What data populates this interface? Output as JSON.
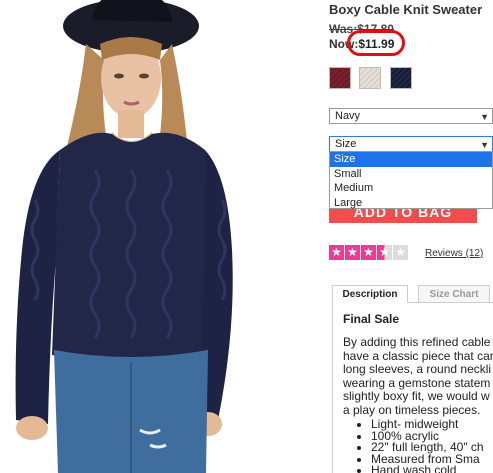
{
  "product": {
    "title": "Boxy Cable Knit Sweater",
    "was_price": "Was:$17.80",
    "now_label": "Now:",
    "now_price": "$11.99"
  },
  "swatches": [
    {
      "name": "burgundy",
      "color": "#6a1a24"
    },
    {
      "name": "cream",
      "color": "#e2dbd0"
    },
    {
      "name": "navy",
      "color": "#1b2140"
    }
  ],
  "color_select": {
    "value": "Navy"
  },
  "size_select": {
    "value": "Size",
    "options": [
      "Size",
      "Small",
      "Medium",
      "Large"
    ],
    "highlighted": "Size"
  },
  "add_to_bag": {
    "label": "ADD TO BAG"
  },
  "rating": {
    "stars": 3.5,
    "max": 5
  },
  "reviews": {
    "label": "Reviews (12)"
  },
  "tabs": [
    {
      "label": "Description",
      "active": true
    },
    {
      "label": "Size Chart",
      "active": false
    }
  ],
  "description": {
    "heading": "Final Sale",
    "lines": [
      "By adding this refined cable",
      "have a classic piece that car",
      "long sleeves, a round neckli",
      "wearing a gemstone statem",
      "slightly boxy fit, we would w",
      "a play on timeless pieces."
    ],
    "bullets": [
      "Light- midweight",
      "100% acrylic",
      "22\" full length, 40\" ch",
      "Measured from Sma",
      "Hand wash cold"
    ]
  },
  "colors": {
    "accent_red": "#e01010",
    "button_red": "#f24d4d",
    "star_pink": "#ec3c8f",
    "select_highlight": "#1e73e8"
  }
}
